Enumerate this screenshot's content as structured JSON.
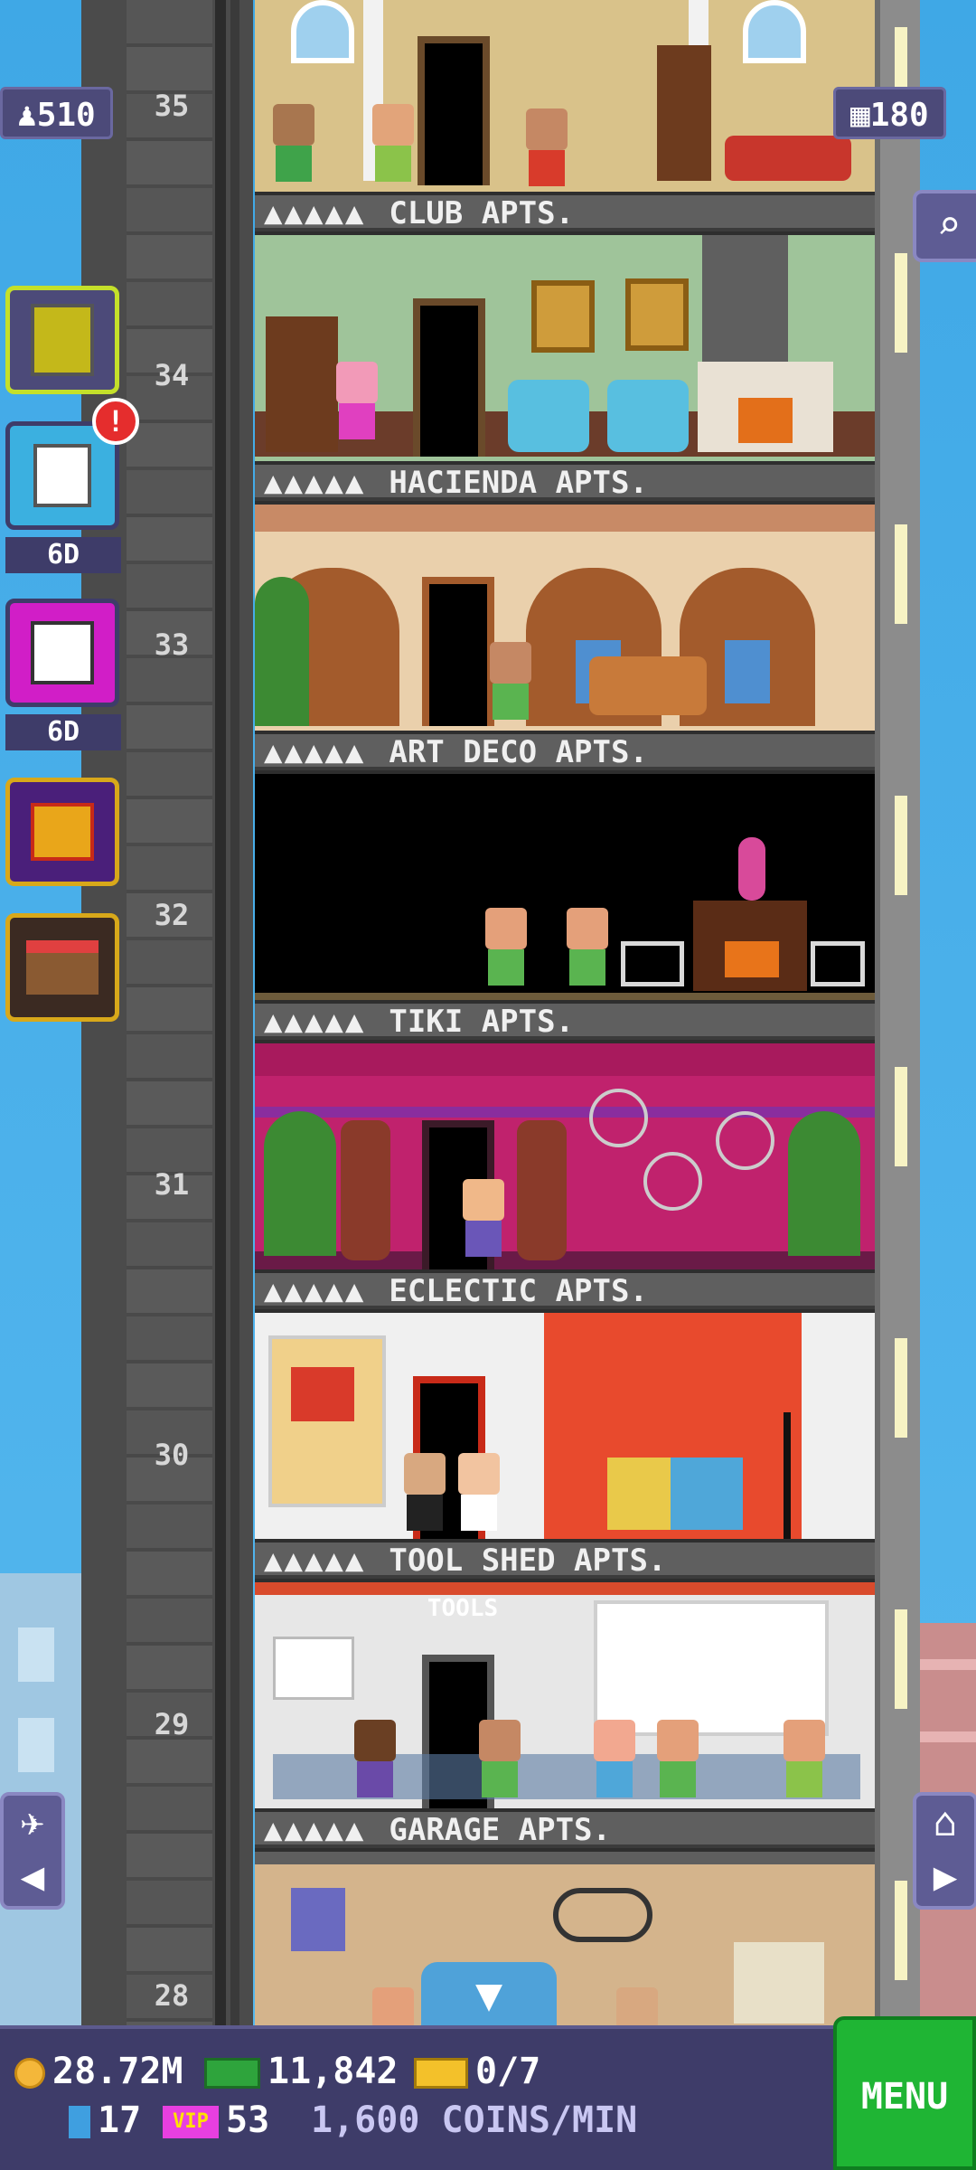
{
  "hud": {
    "population": "510",
    "population_icon": "person-icon",
    "floors": "180",
    "floors_icon": "building-grid-icon"
  },
  "side_buttons": [
    {
      "name": "build-floor-button",
      "icon": "building-icon",
      "caption": ""
    },
    {
      "name": "missions-button",
      "icon": "clipboard-icon",
      "caption": "6D",
      "alert": "!"
    },
    {
      "name": "lucky-dice-button",
      "icon": "dice-icon",
      "caption": "6D"
    },
    {
      "name": "gift-button",
      "icon": "gift-icon",
      "caption": ""
    },
    {
      "name": "shop-button",
      "icon": "market-stall-icon",
      "caption": ""
    }
  ],
  "floors": [
    {
      "number": "35",
      "label": "CLUB APTS.",
      "stars": "▲▲▲▲▲"
    },
    {
      "number": "34",
      "label": "HACIENDA APTS.",
      "stars": "▲▲▲▲▲"
    },
    {
      "number": "33",
      "label": "ART DECO APTS.",
      "stars": "▲▲▲▲▲"
    },
    {
      "number": "32",
      "label": "TIKI APTS.",
      "stars": "▲▲▲▲▲"
    },
    {
      "number": "31",
      "label": "ECLECTIC APTS.",
      "stars": "▲▲▲▲▲"
    },
    {
      "number": "30",
      "label": "TOOL SHED APTS.",
      "stars": "▲▲▲▲▲"
    },
    {
      "number": "29",
      "label": "GARAGE APTS.",
      "stars": "▲▲▲▲▲"
    },
    {
      "number": "28",
      "label": "",
      "stars": ""
    }
  ],
  "tool_sign": "TOOLS",
  "bottom": {
    "coins": "28.72M",
    "bux": "11,842",
    "tickets": "0/7",
    "cubes": "17",
    "vip_tag": "VIP",
    "vip": "53",
    "rate": "1,600 COINS/MIN",
    "menu": "MENU"
  },
  "colors": {
    "sky": "#3fa8e6",
    "hud_panel": "#3e3c69",
    "menu_green": "#1fb534"
  }
}
